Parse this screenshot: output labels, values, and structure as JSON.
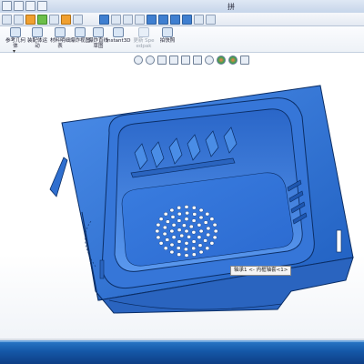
{
  "window": {
    "title": "拼"
  },
  "ribbon": {
    "buttons": [
      {
        "id": "mold-geometry",
        "label": "参考几何体"
      },
      {
        "id": "assembly-motion",
        "label": "装配体运动"
      },
      {
        "id": "material-detail",
        "label": "材料明细表"
      },
      {
        "id": "exploded-view",
        "label": "爆炸视图"
      },
      {
        "id": "explode-line",
        "label": "爆炸直线草图"
      },
      {
        "id": "instant3d",
        "label": "Instant3D"
      },
      {
        "id": "speedpak",
        "label": "更新 Speedpak"
      },
      {
        "id": "snapshot",
        "label": "拍快照"
      }
    ]
  },
  "viewport": {
    "tooltip": "轴承1 <- 内框轴套<1>"
  },
  "colors": {
    "model_blue": "#2f74d6",
    "model_edge": "#0b2e66",
    "taskbar": "#1558a8"
  },
  "icons": {
    "heads_up": [
      "zoom-fit-icon",
      "zoom-area-icon",
      "previous-view-icon",
      "section-view-icon",
      "view-orientation-icon",
      "display-style-icon",
      "hide-show-icon",
      "edit-appearance-icon",
      "apply-scene-icon",
      "view-settings-icon"
    ]
  }
}
